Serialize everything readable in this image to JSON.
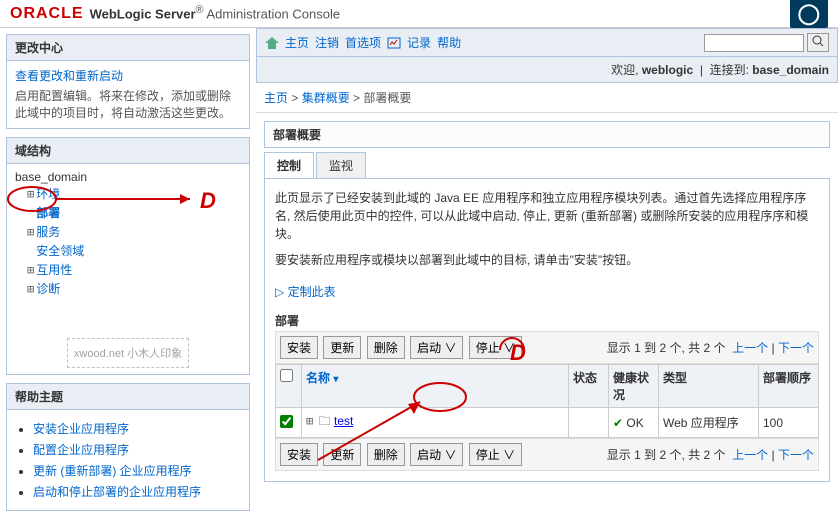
{
  "header": {
    "logo": "ORACLE",
    "product": "WebLogic Server",
    "subtitle": "Administration Console",
    "rightGlyph": "◯"
  },
  "changeCenter": {
    "title": "更改中心",
    "link": "查看更改和重新启动",
    "desc": "启用配置编辑。将来在修改，添加或删除此域中的项目时，将自动激活这些更改。"
  },
  "domainStructure": {
    "title": "域结构",
    "root": "base_domain",
    "items": [
      {
        "label": "环境",
        "toggle": "⊞"
      },
      {
        "label": "部署",
        "toggle": "",
        "selected": true
      },
      {
        "label": "服务",
        "toggle": "⊞"
      },
      {
        "label": "安全领域",
        "toggle": ""
      },
      {
        "label": "互用性",
        "toggle": "⊞"
      },
      {
        "label": "诊断",
        "toggle": "⊞"
      }
    ]
  },
  "watermark": "xwood.net\n小木人印象",
  "helpTopics": {
    "title": "帮助主题",
    "items": [
      "安装企业应用程序",
      "配置企业应用程序",
      "更新 (重新部署) 企业应用程序",
      "启动和停止部署的企业应用程序"
    ]
  },
  "toolbar": {
    "home": "主页",
    "logout": "注销",
    "prefs": "首选项",
    "record": "记录",
    "help": "帮助",
    "welcome_label": "欢迎,",
    "user": "weblogic",
    "connected_label": "连接到:",
    "domain": "base_domain"
  },
  "breadcrumb": {
    "home": "主页",
    "mid": "集群概要",
    "current": "部署概要"
  },
  "main": {
    "pageTitle": "部署概要",
    "tabs": {
      "control": "控制",
      "monitor": "监视"
    },
    "desc1": "此页显示了已经安装到此域的 Java EE 应用程序和独立应用程序模块列表。通过首先选择应用程序序名, 然后使用此页中的控件, 可以从此域中启动, 停止, 更新 (重新部署) 或删除所安装的应用程序序和模块。",
    "desc2": "要安装新应用程序或模块以部署到此域中的目标, 请单击\"安装\"按钮。",
    "customLink": "定制此表",
    "tableTitle": "部署",
    "buttons": {
      "install": "安装",
      "update": "更新",
      "delete": "删除",
      "start": "启动",
      "stop": "停止"
    },
    "paging": {
      "text_prefix": "显示 1 到 2 个, 共 2 个",
      "prev": "上一个",
      "next": "下一个"
    },
    "columns": {
      "name": "名称",
      "state": "状态",
      "health": "健康状况",
      "type": "类型",
      "order": "部署顺序"
    },
    "rows": [
      {
        "name": "test",
        "state": "",
        "health": "OK",
        "type": "Web 应用程序",
        "order": "100",
        "checked": true
      }
    ],
    "chevron": "∨"
  }
}
